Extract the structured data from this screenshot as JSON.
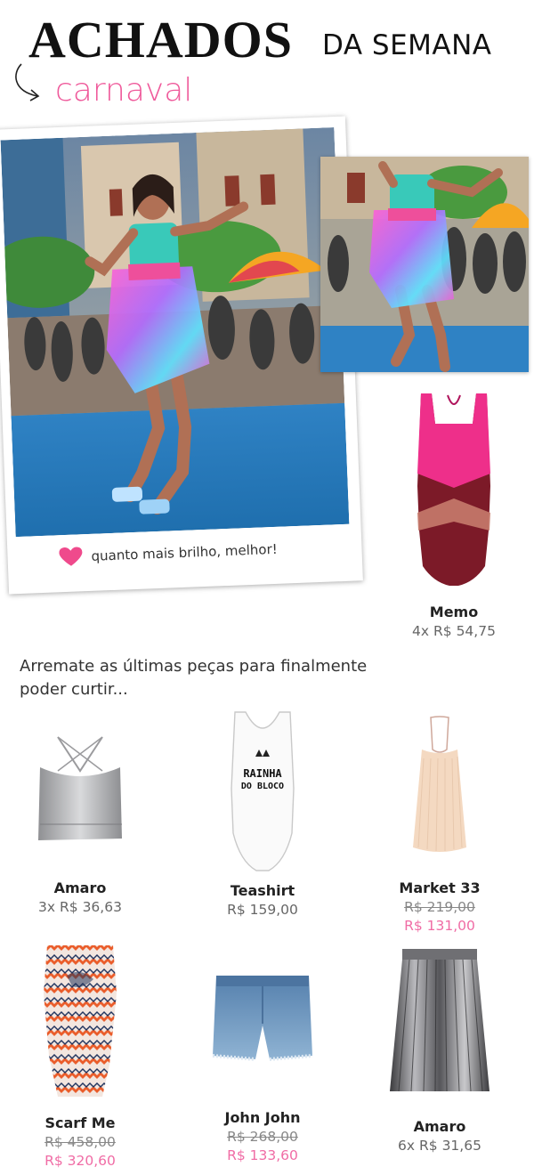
{
  "header": {
    "title_main": "ACHADOS",
    "title_sub": "DA SEMANA",
    "subtitle": "carnaval"
  },
  "colors": {
    "accent": "#ef5a9b",
    "sale": "#f06ca5"
  },
  "photo": {
    "caption": "quanto mais brilho, melhor!",
    "caption_icon": "heart-icon"
  },
  "featured": {
    "brand": "Memo",
    "price": "4x R$ 54,75"
  },
  "intro": "Arremate as últimas peças para finalmente poder curtir...",
  "products": [
    {
      "brand": "Amaro",
      "price": "3x R$ 36,63"
    },
    {
      "brand": "Teashirt",
      "price": "R$ 159,00",
      "print_line1": "RAINHA",
      "print_line2": "DO BLOCO"
    },
    {
      "brand": "Market 33",
      "old_price": "R$ 219,00",
      "sale_price": "R$ 131,00"
    },
    {
      "brand": "Scarf Me",
      "old_price": "R$ 458,00",
      "sale_price": "R$ 320,60"
    },
    {
      "brand": "John John",
      "old_price": "R$ 268,00",
      "sale_price": "R$ 133,60"
    },
    {
      "brand": "Amaro",
      "price": "6x R$ 31,65"
    }
  ]
}
